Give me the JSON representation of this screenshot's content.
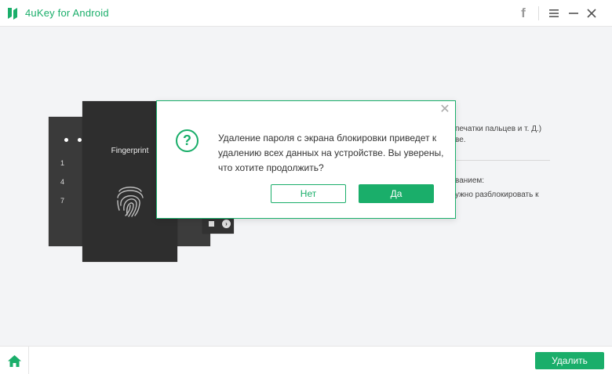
{
  "app": {
    "title": "4uKey for Android",
    "brand_color": "#1aae6a"
  },
  "titlebar": {
    "facebook_icon": "facebook-icon",
    "menu_icon": "menu-icon",
    "minimize_icon": "minimize-icon",
    "close_icon": "close-icon"
  },
  "phones": {
    "pin_numbers": [
      "1",
      "4",
      "7"
    ],
    "fingerprint_label": "Fingerprint"
  },
  "background_text": {
    "line1": "печатки пальцев и т. Д.)",
    "line2": "ве.",
    "line3": "ванием:",
    "line4": "ужно разблокировать к"
  },
  "dialog": {
    "message": "Удаление пароля с экрана блокировки приведет к удалению всех данных на устройстве. Вы уверены, что хотите продолжить?",
    "no_label": "Нет",
    "yes_label": "Да"
  },
  "bottombar": {
    "home_icon": "home-icon",
    "delete_label": "Удалить"
  }
}
